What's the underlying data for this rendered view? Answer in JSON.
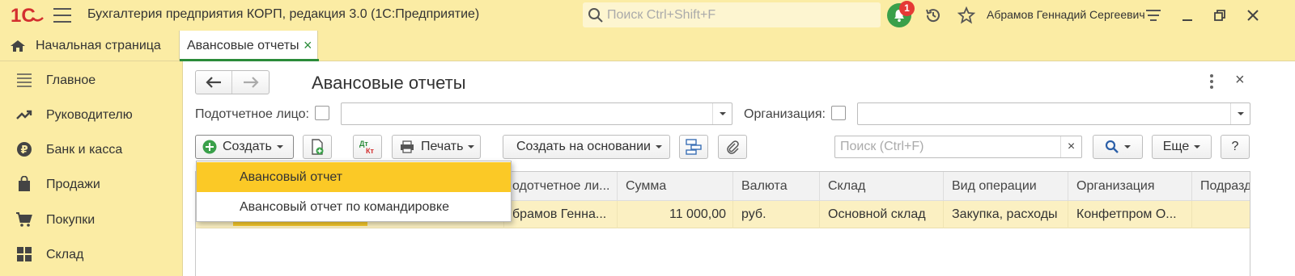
{
  "app": {
    "title": "Бухгалтерия предприятия КОРП, редакция 3.0  (1С:Предприятие)",
    "logo_text": "1С",
    "search_placeholder": "Поиск Ctrl+Shift+F",
    "notifications_count": "1",
    "user_name": "Абрамов Геннадий Сергеевич",
    "accent_color": "#2b8b3a",
    "panel_color": "#fbeca4"
  },
  "tabs": {
    "home": "Начальная страница",
    "active": "Авансовые отчеты",
    "close": "×"
  },
  "sidebar": {
    "items": [
      {
        "label": "Главное",
        "icon": "menu-lines-icon"
      },
      {
        "label": "Руководителю",
        "icon": "trend-icon"
      },
      {
        "label": "Банк и касса",
        "icon": "ruble-icon"
      },
      {
        "label": "Продажи",
        "icon": "shopping-bag-icon"
      },
      {
        "label": "Покупки",
        "icon": "cart-icon"
      },
      {
        "label": "Склад",
        "icon": "grid-icon"
      }
    ]
  },
  "form": {
    "title": "Авансовые отчеты",
    "close": "×",
    "filters": {
      "person_label": "Подотчетное лицо:",
      "org_label": "Организация:"
    },
    "toolbar": {
      "create": "Создать",
      "dt_label": "Дт",
      "kt_label": "Кт",
      "print": "Печать",
      "create_based": "Создать на основании",
      "search_placeholder": "Поиск (Ctrl+F)",
      "clear": "×",
      "more": "Еще",
      "help": "?"
    },
    "create_menu": {
      "items": [
        "Авансовый отчет",
        "Авансовый отчет по командировке"
      ],
      "selected": 0
    },
    "table": {
      "columns": [
        "одотчетное ли...",
        "Сумма",
        "Валюта",
        "Склад",
        "Вид операции",
        "Организация",
        "Подразд"
      ],
      "rows": [
        {
          "person": "брамов Генна...",
          "sum": "11 000,00",
          "currency": "руб.",
          "warehouse": "Основной склад",
          "operation": "Закупка, расходы",
          "org": "Конфетпром О...",
          "division": ""
        }
      ]
    }
  }
}
